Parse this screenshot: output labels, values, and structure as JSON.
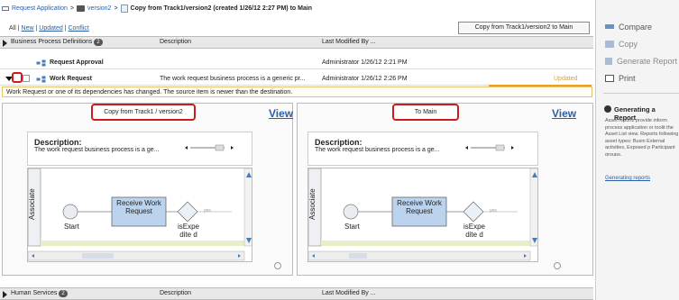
{
  "breadcrumb": {
    "app": "Request Application",
    "sep1": ">",
    "version": "version2",
    "sep2": ">",
    "title": "Copy from Track1/version2 (created 1/26/12 2:27 PM) to Main"
  },
  "filters": {
    "all": "All",
    "sep": "|",
    "new": "New",
    "updated": "Updated",
    "conflict": "Conflict"
  },
  "copy_button": "Copy from Track1/version2 to Main",
  "groups": [
    {
      "title": "Business Process Definitions",
      "count": "2",
      "description": "Description",
      "modified": "Last Modified By ..."
    },
    {
      "title": "Human Services",
      "count": "2",
      "description": "Description",
      "modified": "Last Modified By ..."
    }
  ],
  "rows": [
    {
      "name": "Request Approval",
      "description": "",
      "modified": "Administrator 1/26/12 2:21 PM",
      "status": ""
    },
    {
      "name": "Work Request",
      "description": "The work request business process is a generic pr...",
      "modified": "Administrator 1/26/12 2:26 PM",
      "status": "Updated"
    }
  ],
  "warning": "Work Request or one of its dependencies has changed. The source item is newer than the destination.",
  "left_panel": {
    "button": "Copy from Track1 / version2",
    "view": "View",
    "desc_heading": "Description:",
    "desc_text": "The work request business process is a ge...",
    "lane": "Associate",
    "start": "Start",
    "task": "Receive Work Request",
    "gateway": "isExpedite d",
    "yes": "yes"
  },
  "right_panel": {
    "button": "To Main",
    "view": "View",
    "desc_heading": "Description:",
    "desc_text": "The work request business process is a ge...",
    "lane": "Associate",
    "start": "Start",
    "task": "Receive Work Request",
    "gateway": "isExpedite d",
    "yes": "yes"
  },
  "actions": [
    {
      "label": "Compare",
      "icon": "compare-icon"
    },
    {
      "label": "Copy",
      "icon": "copy-icon"
    },
    {
      "label": "Generate Report",
      "icon": "report-icon"
    },
    {
      "label": "Print",
      "icon": "print-icon"
    }
  ],
  "help": {
    "title": "Generating a Report",
    "text": "Asset reports provide inform process application or toolit the Asset List view. Reports following asset types: Busin External activities, Exposed p Participant groups.",
    "link": "Generating reports"
  },
  "colors": {
    "highlight": "#d0191d",
    "updated": "#f0a020",
    "link": "#2a5fa8",
    "task_fill": "#bcd3ee"
  }
}
